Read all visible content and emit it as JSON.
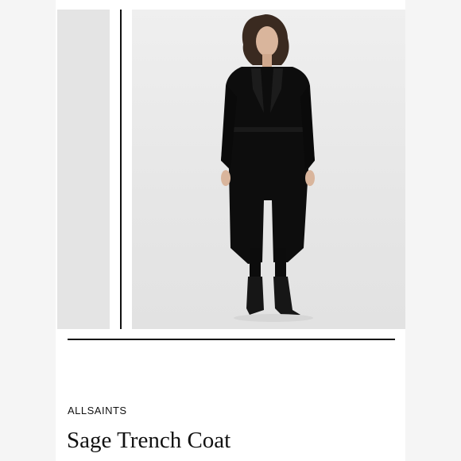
{
  "brand": "ALLSAINTS",
  "product": {
    "title": "Sage Trench Coat",
    "color_swatch": "#0d0d0d"
  },
  "colors": {
    "background": "#ffffff",
    "side_panel": "#f5f5f5",
    "photo_bg": "#e8e8e8",
    "accent_line": "#111111"
  }
}
